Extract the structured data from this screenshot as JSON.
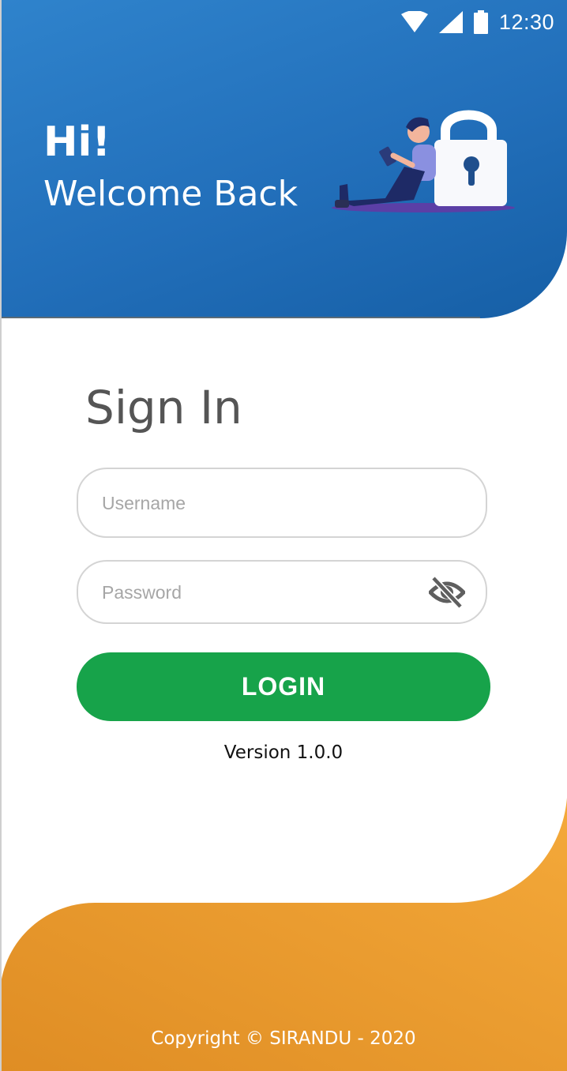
{
  "status_bar": {
    "time": "12:30",
    "icons": [
      "wifi-icon",
      "signal-icon",
      "battery-icon"
    ]
  },
  "header": {
    "greeting": "Hi!",
    "subtitle": "Welcome Back",
    "illustration": "person-with-padlock-illustration"
  },
  "form": {
    "title": "Sign In",
    "username_placeholder": "Username",
    "password_placeholder": "Password",
    "password_toggle_icon": "eye-off-icon",
    "login_label": "LOGIN"
  },
  "version": "Version 1.0.0",
  "footer": {
    "copyright": "Copyright © SIRANDU - 2020"
  },
  "colors": {
    "header_blue": "#226fba",
    "login_green": "#17a34a",
    "footer_orange": "#f0a533",
    "title_gray": "#555555"
  }
}
